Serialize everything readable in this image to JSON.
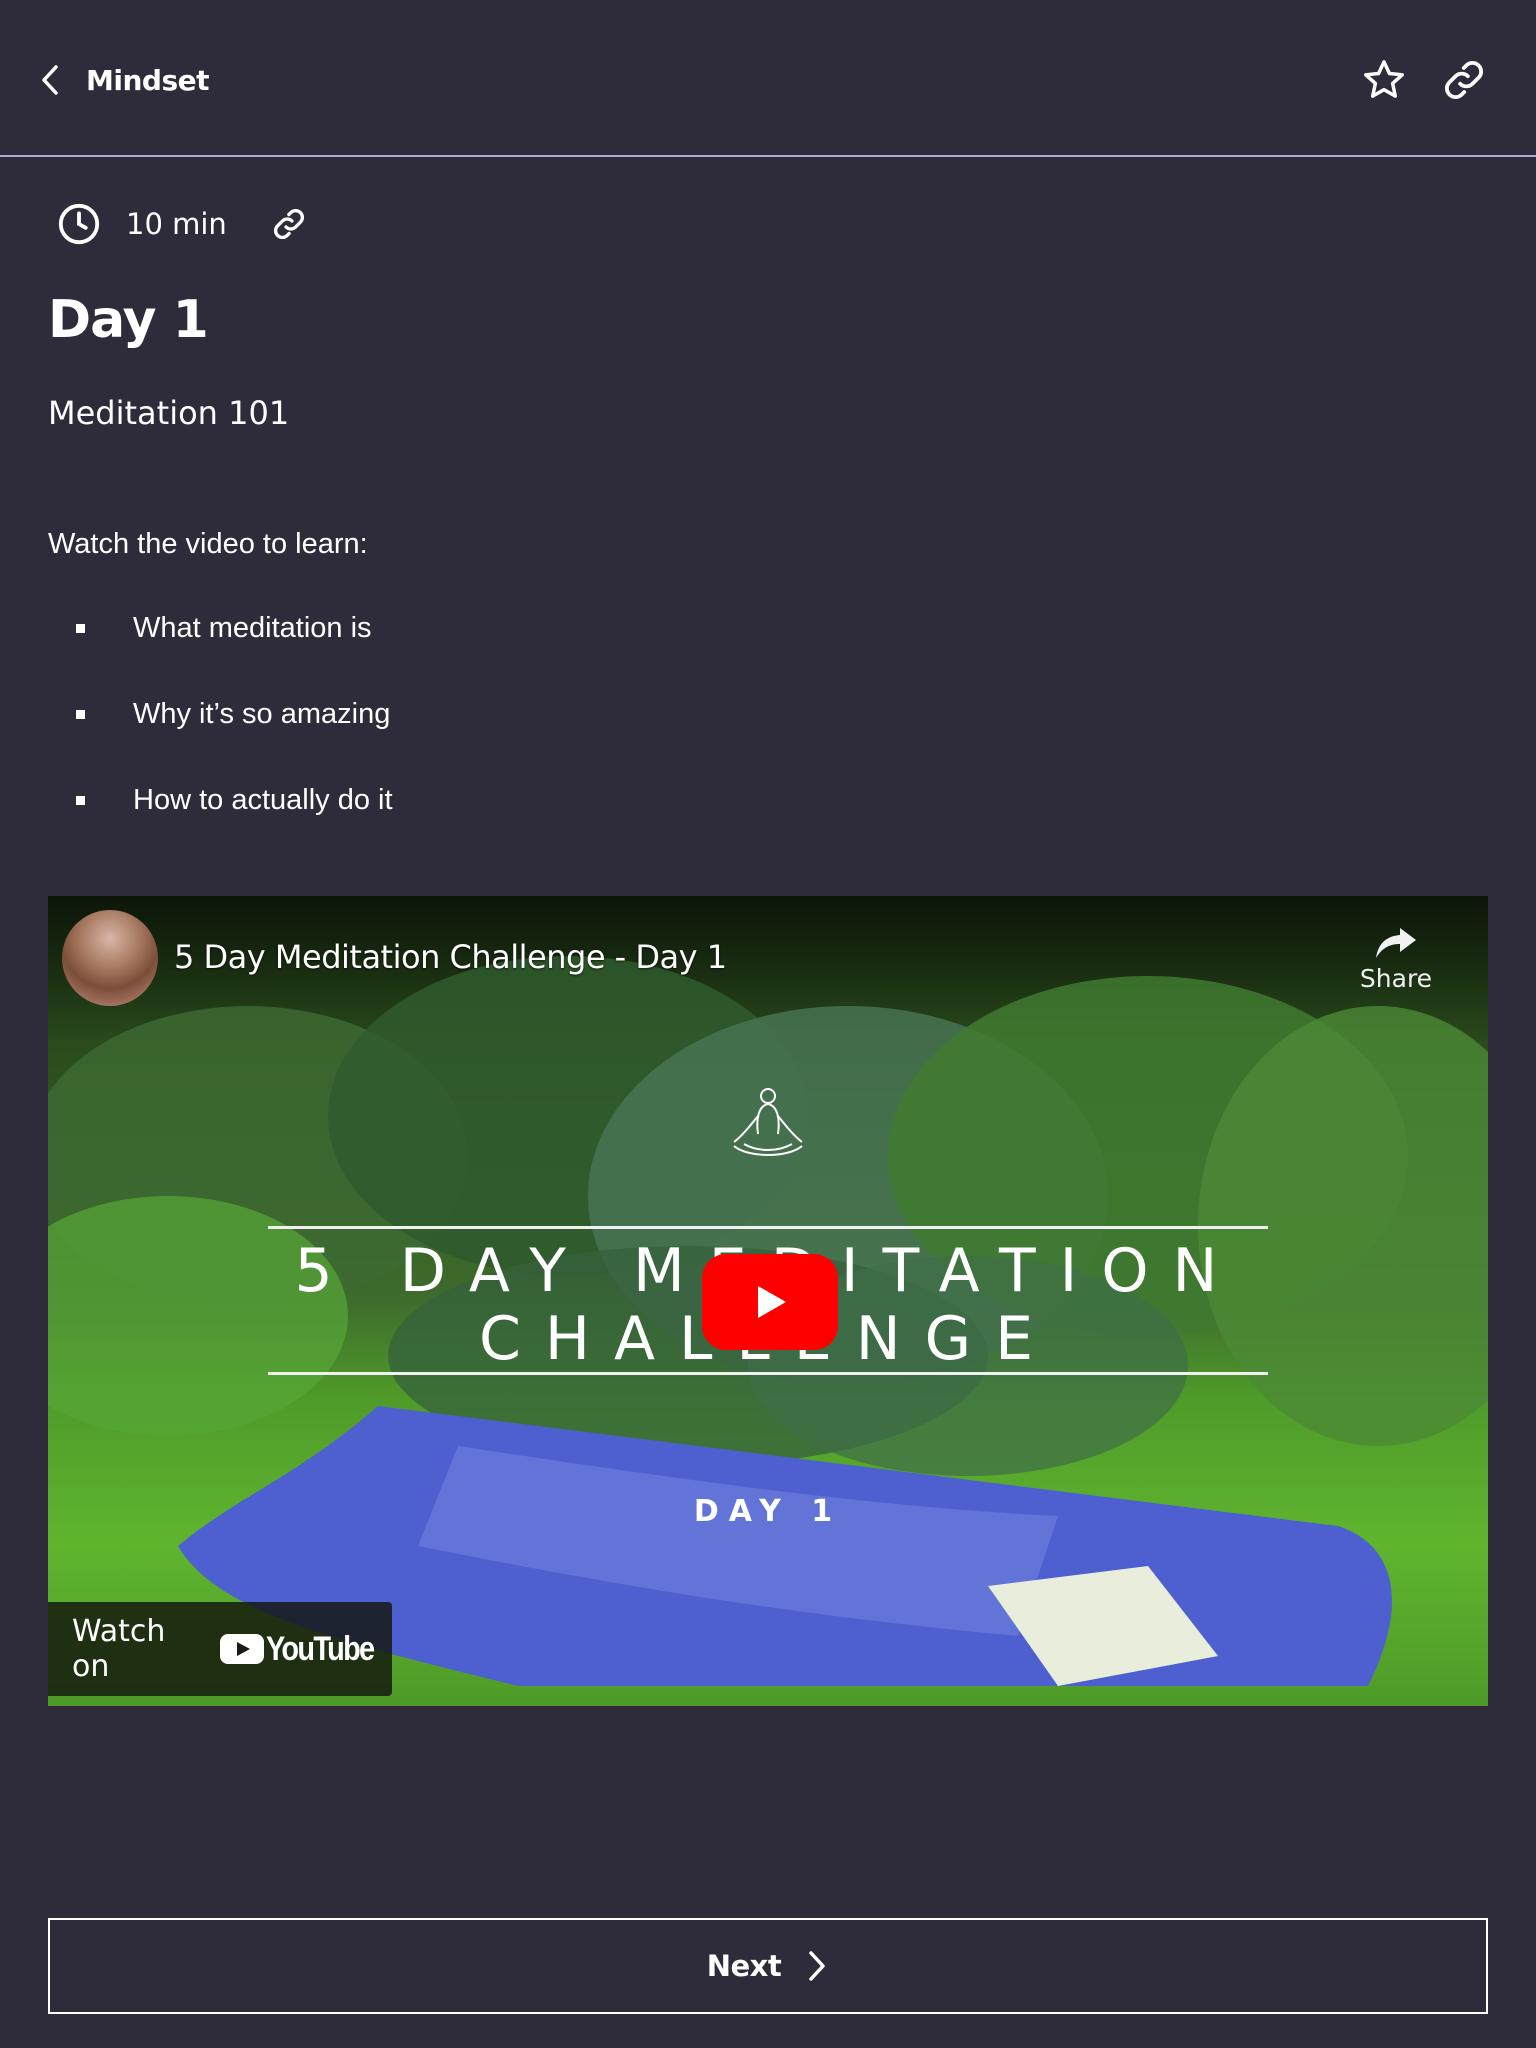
{
  "header": {
    "back_label": "Mindset",
    "icons": {
      "back": "chevron-left-icon",
      "favorite": "star-outline-icon",
      "share_link": "link-icon"
    }
  },
  "meta": {
    "duration": "10 min",
    "icons": {
      "duration": "clock-icon",
      "copy_link": "link-icon"
    }
  },
  "content": {
    "title": "Day 1",
    "subtitle": "Meditation 101",
    "intro": "Watch the video to learn:",
    "bullets": [
      "What meditation is",
      "Why it’s so amazing",
      "How to actually do it"
    ]
  },
  "video": {
    "title": "5 Day Meditation Challenge - Day 1",
    "share_label": "Share",
    "thumbnail_line1": "5 DAY MEDITATION",
    "thumbnail_line2": "CHALLENGE",
    "thumbnail_day": "DAY 1",
    "watch_on_label": "Watch on",
    "platform_label": "YouTube",
    "play_button_color": "#ff0000",
    "icons": {
      "avatar": "channel-avatar",
      "share": "share-arrow-icon",
      "play": "play-icon",
      "thumbnail_figure": "meditation-pose-icon",
      "platform_logo": "youtube-logo-icon"
    }
  },
  "footer": {
    "next_label": "Next",
    "icons": {
      "next": "chevron-right-icon"
    }
  },
  "colors": {
    "background": "#2e2c3a",
    "header_divider": "#b3a9d6",
    "text": "#ffffff"
  }
}
